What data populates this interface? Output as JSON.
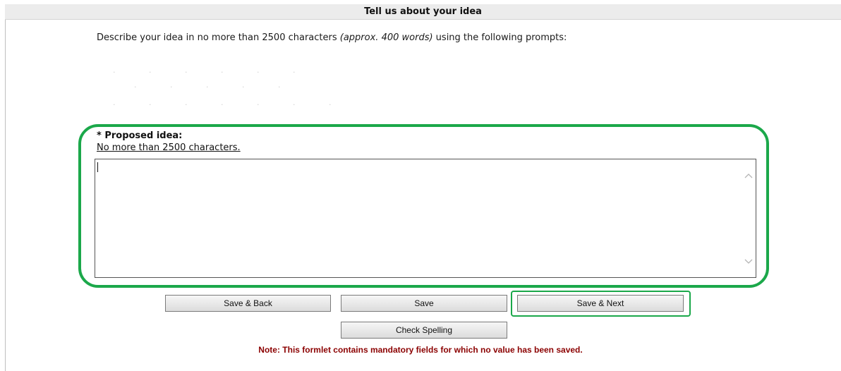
{
  "header": {
    "title": "Tell us about your idea"
  },
  "intro": {
    "text_before": "Describe your idea in no more than 2500 characters ",
    "text_italic": "(approx. 400 words)",
    "text_after": " using the following prompts:"
  },
  "field": {
    "label": "* Proposed idea:",
    "hint": "No more than 2500 characters.",
    "value": "",
    "placeholder": ""
  },
  "buttons": {
    "save_back": "Save & Back",
    "save": "Save",
    "save_next": "Save & Next",
    "check_spelling": "Check Spelling"
  },
  "note": "Note: This formlet contains mandatory fields for which no value has been saved.",
  "colors": {
    "highlight": "#1ba84a",
    "note": "#8b0000",
    "header_bg": "#ececec"
  },
  "icons": {
    "scroll_up": "chevron-up-icon",
    "scroll_down": "chevron-down-icon"
  }
}
